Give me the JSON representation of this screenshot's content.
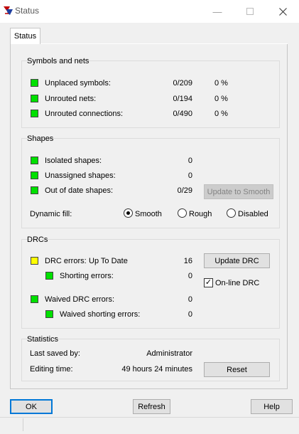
{
  "window": {
    "title": "Status"
  },
  "tab": {
    "label": "Status"
  },
  "symbols_nets": {
    "title": "Symbols and nets",
    "rows": [
      {
        "label": "Unplaced symbols:",
        "count": "0/209",
        "percent": "0 %"
      },
      {
        "label": "Unrouted nets:",
        "count": "0/194",
        "percent": "0 %"
      },
      {
        "label": "Unrouted connections:",
        "count": "0/490",
        "percent": "0 %"
      }
    ]
  },
  "shapes": {
    "title": "Shapes",
    "isolated_label": "Isolated shapes:",
    "isolated_value": "0",
    "unassigned_label": "Unassigned shapes:",
    "unassigned_value": "0",
    "outofdate_label": "Out of date shapes:",
    "outofdate_value": "0/29",
    "update_button": "Update to Smooth",
    "dynamic_fill_label": "Dynamic fill:",
    "fill_options": [
      "Smooth",
      "Rough",
      "Disabled"
    ],
    "fill_selected": "Smooth"
  },
  "drcs": {
    "title": "DRCs",
    "drc_errors_label": "DRC errors:",
    "drc_status": "Up To Date",
    "drc_errors_value": "16",
    "shorting_label": "Shorting errors:",
    "shorting_value": "0",
    "waived_label": "Waived DRC errors:",
    "waived_value": "0",
    "waived_shorting_label": "Waived shorting errors:",
    "waived_shorting_value": "0",
    "update_button": "Update DRC",
    "online_label": "On-line DRC",
    "online_checked": true
  },
  "statistics": {
    "title": "Statistics",
    "last_saved_label": "Last saved by:",
    "last_saved_value": "Administrator",
    "editing_time_label": "Editing time:",
    "editing_time_value": "49 hours 24 minutes",
    "reset_button": "Reset"
  },
  "footer": {
    "ok": "OK",
    "refresh": "Refresh",
    "help": "Help"
  },
  "colors": {
    "indicator_green": "#00e000",
    "indicator_yellow": "#ffff00",
    "default_button_border": "#0078d7"
  }
}
